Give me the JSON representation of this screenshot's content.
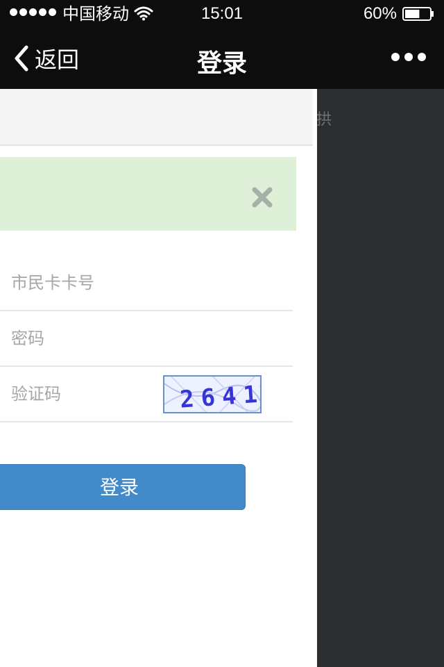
{
  "status_bar": {
    "carrier": "中国移动",
    "time": "15:01",
    "battery": "60%",
    "battery_level": 0.6
  },
  "nav": {
    "back_label": "返回",
    "title": "登录"
  },
  "drawer": {
    "peek_text": "拱"
  },
  "form": {
    "card_placeholder": "市民卡卡号",
    "password_placeholder": "密码",
    "captcha_placeholder": "验证码",
    "captcha_text": "2641",
    "login_label": "登录"
  },
  "colors": {
    "nav_bg": "#0d0d0d",
    "alert_bg": "#dff0d8",
    "button_bg": "#428bca",
    "drawer_bg": "#2b2d2f"
  }
}
